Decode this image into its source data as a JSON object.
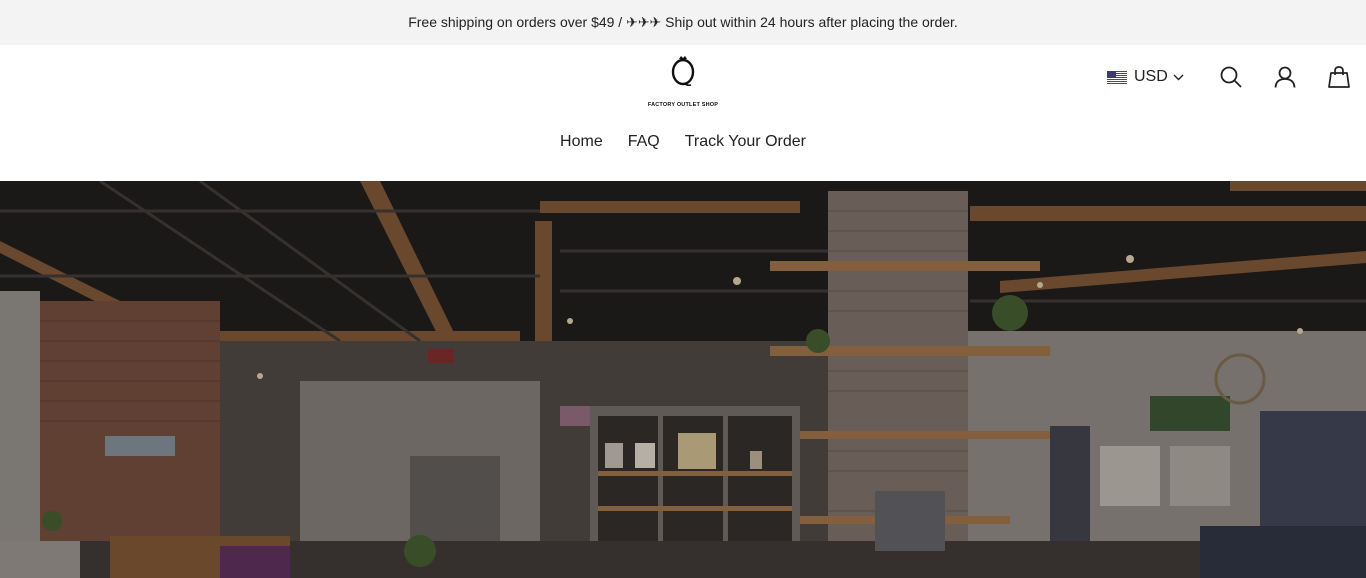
{
  "announcement": {
    "text": "Free shipping on orders over $49 / ✈✈✈ Ship out within 24 hours after placing the order."
  },
  "header": {
    "logo_text": "FACTORY OUTLET SHOP",
    "currency": {
      "code": "USD",
      "flag_icon": "us-flag-icon"
    },
    "icons": [
      "search-icon",
      "account-icon",
      "cart-icon"
    ]
  },
  "nav": {
    "items": [
      {
        "label": "Home"
      },
      {
        "label": "FAQ"
      },
      {
        "label": "Track Your Order"
      }
    ]
  },
  "hero": {
    "image": "store-interior-photo"
  },
  "colors": {
    "announcement_bg": "#f3f3f3",
    "text": "#222222",
    "hero_overlay": "#1a1714"
  }
}
